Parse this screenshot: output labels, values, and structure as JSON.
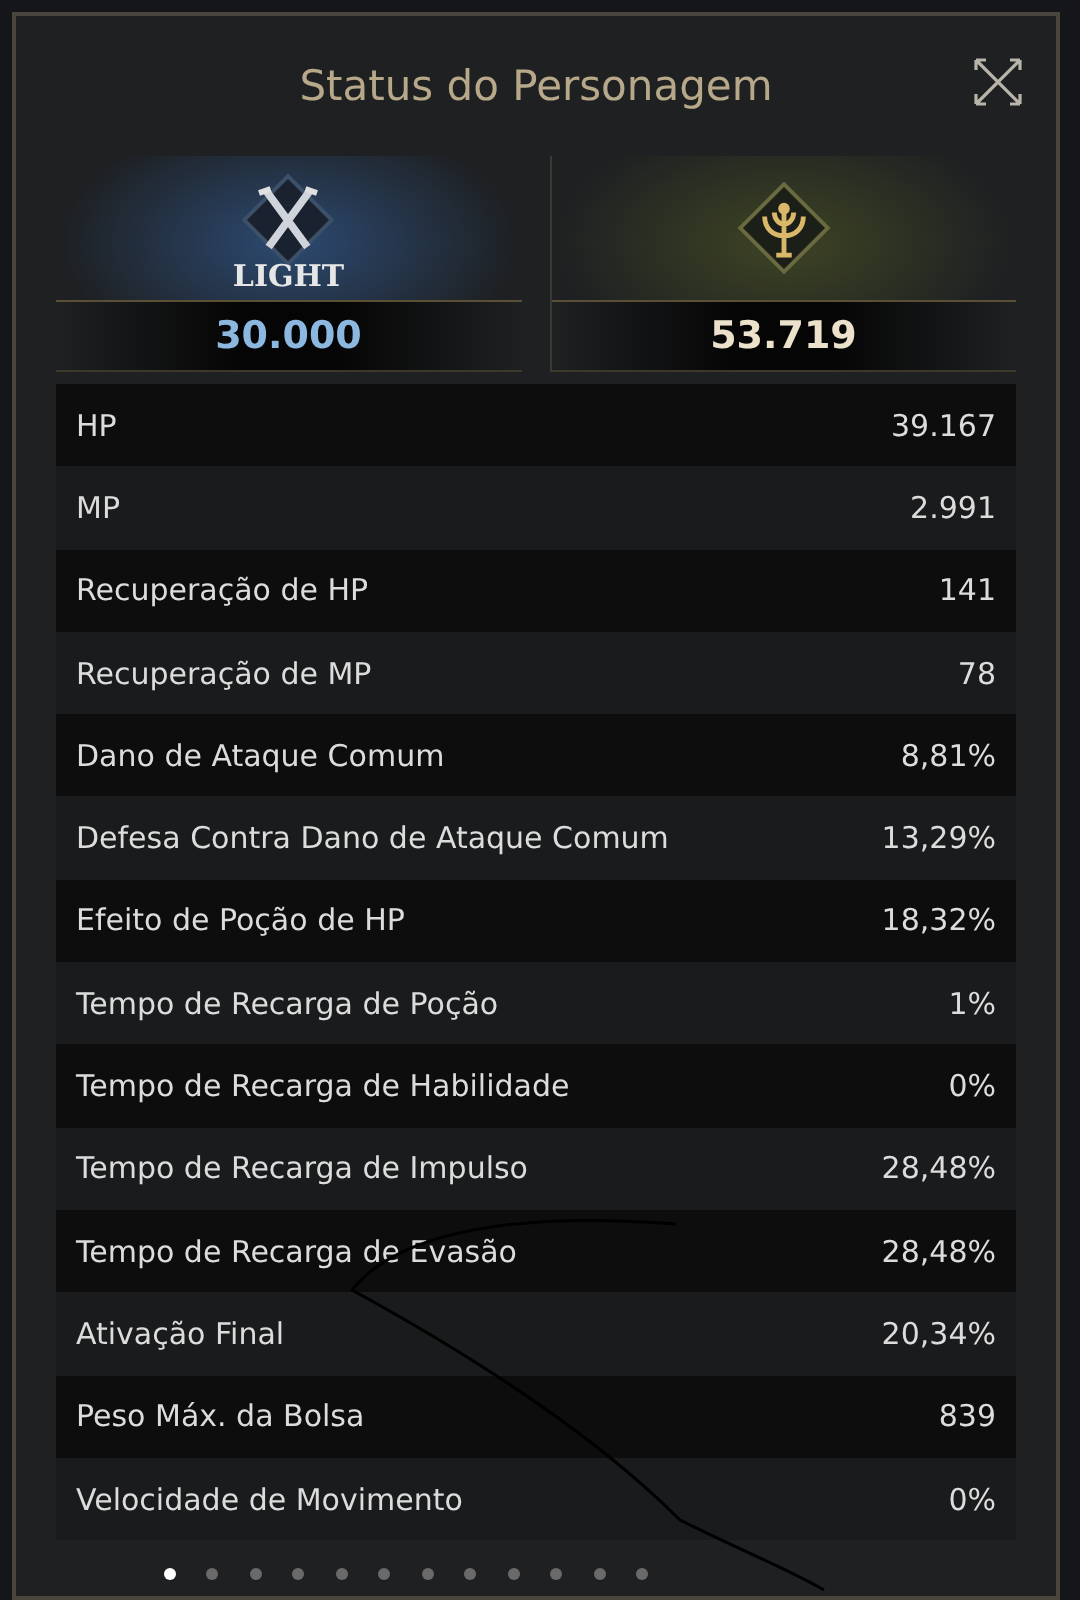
{
  "window": {
    "title": "Status do Personagem"
  },
  "factions": [
    {
      "kind": "light",
      "emblem_label": "LIGHT",
      "value": "30.000"
    },
    {
      "kind": "tree",
      "value": "53.719"
    }
  ],
  "stats": [
    {
      "label": "HP",
      "value": "39.167"
    },
    {
      "label": "MP",
      "value": "2.991"
    },
    {
      "label": "Recuperação de HP",
      "value": "141"
    },
    {
      "label": "Recuperação de MP",
      "value": "78"
    },
    {
      "label": "Dano de Ataque Comum",
      "value": "8,81%"
    },
    {
      "label": "Defesa Contra Dano de Ataque Comum",
      "value": "13,29%"
    },
    {
      "label": "Efeito de Poção de HP",
      "value": "18,32%"
    },
    {
      "label": "Tempo de Recarga de Poção",
      "value": "1%"
    },
    {
      "label": "Tempo de Recarga de Habilidade",
      "value": "0%"
    },
    {
      "label": "Tempo de Recarga de Impulso",
      "value": "28,48%"
    },
    {
      "label": "Tempo de Recarga de Evasão",
      "value": "28,48%"
    },
    {
      "label": "Ativação Final",
      "value": "20,34%"
    },
    {
      "label": "Peso Máx. da Bolsa",
      "value": "839"
    },
    {
      "label": "Velocidade de Movimento",
      "value": "0%"
    }
  ],
  "pages": [
    {
      "selected": true
    },
    {
      "selected": false
    },
    {
      "selected": false
    },
    {
      "selected": false
    },
    {
      "selected": false
    },
    {
      "selected": false
    },
    {
      "selected": false
    },
    {
      "selected": false
    },
    {
      "selected": false
    },
    {
      "selected": false
    },
    {
      "selected": false
    },
    {
      "selected": false
    }
  ],
  "scribble": true
}
